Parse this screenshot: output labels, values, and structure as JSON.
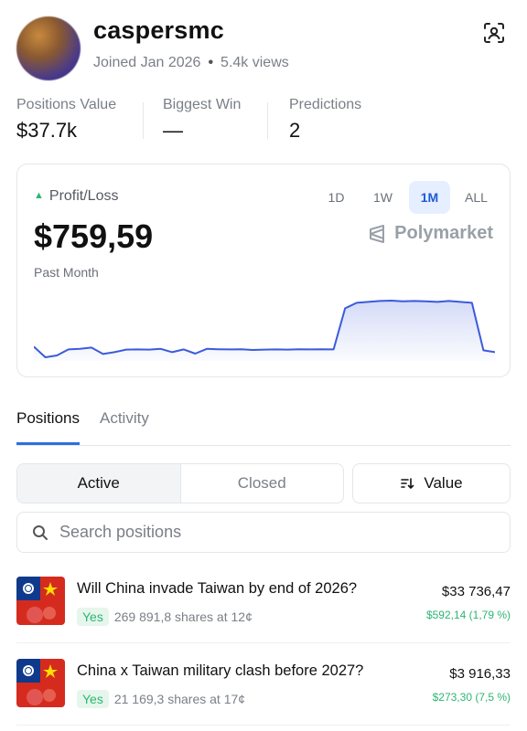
{
  "profile": {
    "username": "caspersmc",
    "joined": "Joined Jan 2026",
    "views": "5.4k views"
  },
  "stats": [
    {
      "label": "Positions Value",
      "value": "$37.7k"
    },
    {
      "label": "Biggest Win",
      "value": "—"
    },
    {
      "label": "Predictions",
      "value": "2"
    }
  ],
  "pnl": {
    "label": "Profit/Loss",
    "value": "$759,59",
    "period": "Past Month",
    "ranges": [
      "1D",
      "1W",
      "1M",
      "ALL"
    ],
    "active_range": "1M",
    "brand": "Polymarket",
    "accent": "#3b5bdb"
  },
  "chart_data": {
    "type": "area",
    "x": [
      0,
      1,
      2,
      3,
      4,
      5,
      6,
      7,
      8,
      9,
      10,
      11,
      12,
      13,
      14,
      15,
      16,
      17,
      18,
      19,
      20,
      21,
      22,
      23,
      24,
      25,
      26,
      27,
      28,
      29,
      30,
      31,
      32,
      33,
      34,
      35,
      36,
      37,
      38,
      39,
      40
    ],
    "values": [
      60,
      2,
      12,
      45,
      48,
      55,
      20,
      30,
      44,
      45,
      44,
      48,
      30,
      45,
      22,
      48,
      46,
      45,
      46,
      42,
      44,
      45,
      44,
      46,
      45,
      46,
      45,
      270,
      300,
      305,
      310,
      312,
      308,
      310,
      308,
      305,
      310,
      305,
      300,
      40,
      30
    ],
    "title": "",
    "xlabel": "",
    "ylabel": ""
  },
  "tabs": {
    "positions": "Positions",
    "activity": "Activity"
  },
  "filters": {
    "active": "Active",
    "closed": "Closed",
    "sort": "Value"
  },
  "search": {
    "placeholder": "Search positions"
  },
  "positions": [
    {
      "title": "Will China invade Taiwan by end of 2026?",
      "outcome": "Yes",
      "shares": "269 891,8 shares at 12¢",
      "value": "$33 736,47",
      "pnl": "$592,14 (1,79 %)"
    },
    {
      "title": "China x Taiwan military clash before 2027?",
      "outcome": "Yes",
      "shares": "21 169,3 shares at 17¢",
      "value": "$3 916,33",
      "pnl": "$273,30 (7,5 %)"
    }
  ]
}
